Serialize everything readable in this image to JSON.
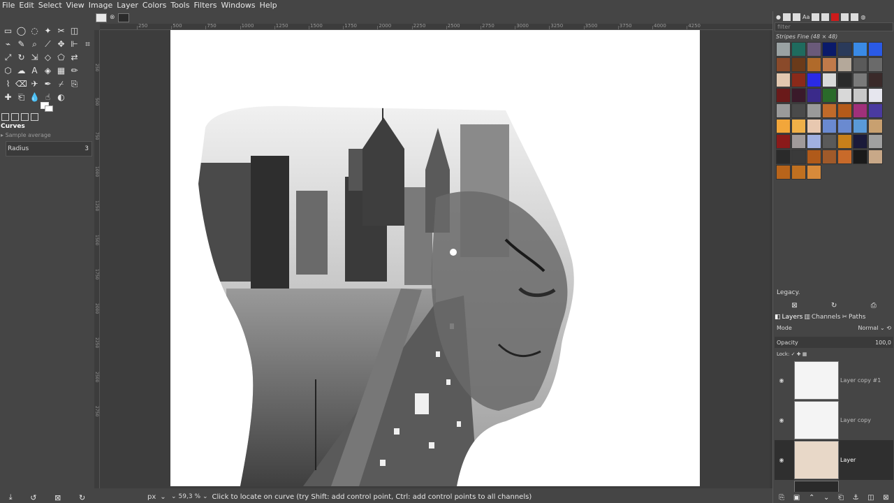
{
  "menubar": [
    "File",
    "Edit",
    "Select",
    "View",
    "Image",
    "Layer",
    "Colors",
    "Tools",
    "Filters",
    "Windows",
    "Help"
  ],
  "tools": [
    {
      "icon": "rect-select-icon",
      "g": "▭"
    },
    {
      "icon": "ellipse-select-icon",
      "g": "◯"
    },
    {
      "icon": "free-select-icon",
      "g": "◌"
    },
    {
      "icon": "fuzzy-select-icon",
      "g": "✦"
    },
    {
      "icon": "scissors-select-icon",
      "g": "✂"
    },
    {
      "icon": "foreground-select-icon",
      "g": "◫"
    },
    {
      "icon": "unused",
      "g": ""
    },
    {
      "icon": "paths-icon",
      "g": "⌁"
    },
    {
      "icon": "color-picker-icon",
      "g": "✎"
    },
    {
      "icon": "zoom-icon",
      "g": "⌕"
    },
    {
      "icon": "measure-icon",
      "g": "⟋"
    },
    {
      "icon": "move-icon",
      "g": "✥"
    },
    {
      "icon": "align-icon",
      "g": "⊩"
    },
    {
      "icon": "crop-icon",
      "g": "⌗"
    },
    {
      "icon": "unified-transform-icon",
      "g": "⤢"
    },
    {
      "icon": "rotate-icon",
      "g": "↻"
    },
    {
      "icon": "scale-icon",
      "g": "⇲"
    },
    {
      "icon": "shear-icon",
      "g": "◇"
    },
    {
      "icon": "perspective-icon",
      "g": "⬠"
    },
    {
      "icon": "flip-icon",
      "g": "⇄"
    },
    {
      "icon": "unused",
      "g": ""
    },
    {
      "icon": "cage-icon",
      "g": "⬡"
    },
    {
      "icon": "warp-icon",
      "g": "☁"
    },
    {
      "icon": "text-icon",
      "g": "A"
    },
    {
      "icon": "bucket-fill-icon",
      "g": "◈"
    },
    {
      "icon": "blend-icon",
      "g": "▦"
    },
    {
      "icon": "pencil-icon",
      "g": "✏"
    },
    {
      "icon": "unused",
      "g": ""
    },
    {
      "icon": "paintbrush-icon",
      "g": "⌇"
    },
    {
      "icon": "eraser-icon",
      "g": "⌫"
    },
    {
      "icon": "airbrush-icon",
      "g": "✈"
    },
    {
      "icon": "ink-icon",
      "g": "✒"
    },
    {
      "icon": "mypaint-brush-icon",
      "g": "⌿"
    },
    {
      "icon": "clone-icon",
      "g": "⎘"
    },
    {
      "icon": "unused",
      "g": ""
    },
    {
      "icon": "heal-icon",
      "g": "✚"
    },
    {
      "icon": "perspective-clone-icon",
      "g": "⎗"
    },
    {
      "icon": "blur-icon",
      "g": "💧"
    },
    {
      "icon": "smudge-icon",
      "g": "☝"
    },
    {
      "icon": "dodge-burn-icon",
      "g": "◐"
    },
    {
      "icon": "unused",
      "g": ""
    },
    {
      "icon": "unused",
      "g": ""
    }
  ],
  "tool_options": {
    "title": "Curves",
    "sample_average": "Sample average",
    "radius_label": "Radius",
    "radius_value": "3"
  },
  "ruler": {
    "h_labels": [
      "250",
      "500",
      "750",
      "1000",
      "1250",
      "1500",
      "1750",
      "2000",
      "2250",
      "2500",
      "2750",
      "3000",
      "3250",
      "3500",
      "3750",
      "4000",
      "4250"
    ],
    "v_labels": [
      "250",
      "500",
      "750",
      "1000",
      "1250",
      "1500",
      "1750",
      "2000",
      "2250",
      "2500",
      "2750"
    ]
  },
  "status": {
    "unit": "px",
    "zoom": "59,3 %",
    "message": "Click to locate on curve (try Shift: add control point, Ctrl: add control points to all channels)"
  },
  "patterns": {
    "filter_placeholder": "filter",
    "selected_name": "Stripes Fine (48 × 48)",
    "colors": [
      "#9aa2a3",
      "#1f6b5e",
      "#6a5a7a",
      "#0a1a6a",
      "#2a3a5a",
      "#3a8ae6",
      "#2a5ae6",
      "#8a4a2a",
      "#6a3a1a",
      "#b06a2a",
      "#c07a4a",
      "#b4a89a",
      "#5a5a5a",
      "#6a6a6a",
      "#e2c8b0",
      "#8a2a1a",
      "#2a2ae6",
      "#dadada",
      "#2a2a2a",
      "#7a7a7a",
      "#3a2a2a",
      "#6a1a1a",
      "#3a1a2a",
      "#3a2a8a",
      "#2a6a2a",
      "#d8d8d8",
      "#c8c8c8",
      "#e6e6ee",
      "#9a9a9a",
      "#4a4a4a",
      "#9a9a9a",
      "#c06a2a",
      "#b45a1a",
      "#a0307a",
      "#4a3aa0",
      "#f2a63a",
      "#f0b048",
      "#e8c8b0",
      "#6a8ad0",
      "#6a8ad0",
      "#5a9ad8",
      "#c8a070",
      "#8a1a1a",
      "#a09a9a",
      "#a0b0e0",
      "#5a5a5a",
      "#c8801a",
      "#1a1a3a",
      "#a0a0a0",
      "#2a2a2a",
      "#3a3a3a",
      "#b05a1a",
      "#a05a2a",
      "#c86a2a",
      "#1a1a1a",
      "#c8a888",
      "#b8641a",
      "#c07020",
      "#d88a3a"
    ],
    "mode_label": "Legacy."
  },
  "layers_panel": {
    "tabs": [
      "Layers",
      "Channels",
      "Paths"
    ],
    "mode_label": "Mode",
    "mode_value": "Normal",
    "opacity_label": "Opacity",
    "opacity_value": "100,0",
    "lock_label": "Lock:",
    "layers": [
      {
        "name": "Layer copy #1",
        "selected": false
      },
      {
        "name": "Layer copy",
        "selected": false
      },
      {
        "name": "Layer",
        "selected": true
      },
      {
        "name": "",
        "selected": false
      }
    ]
  }
}
